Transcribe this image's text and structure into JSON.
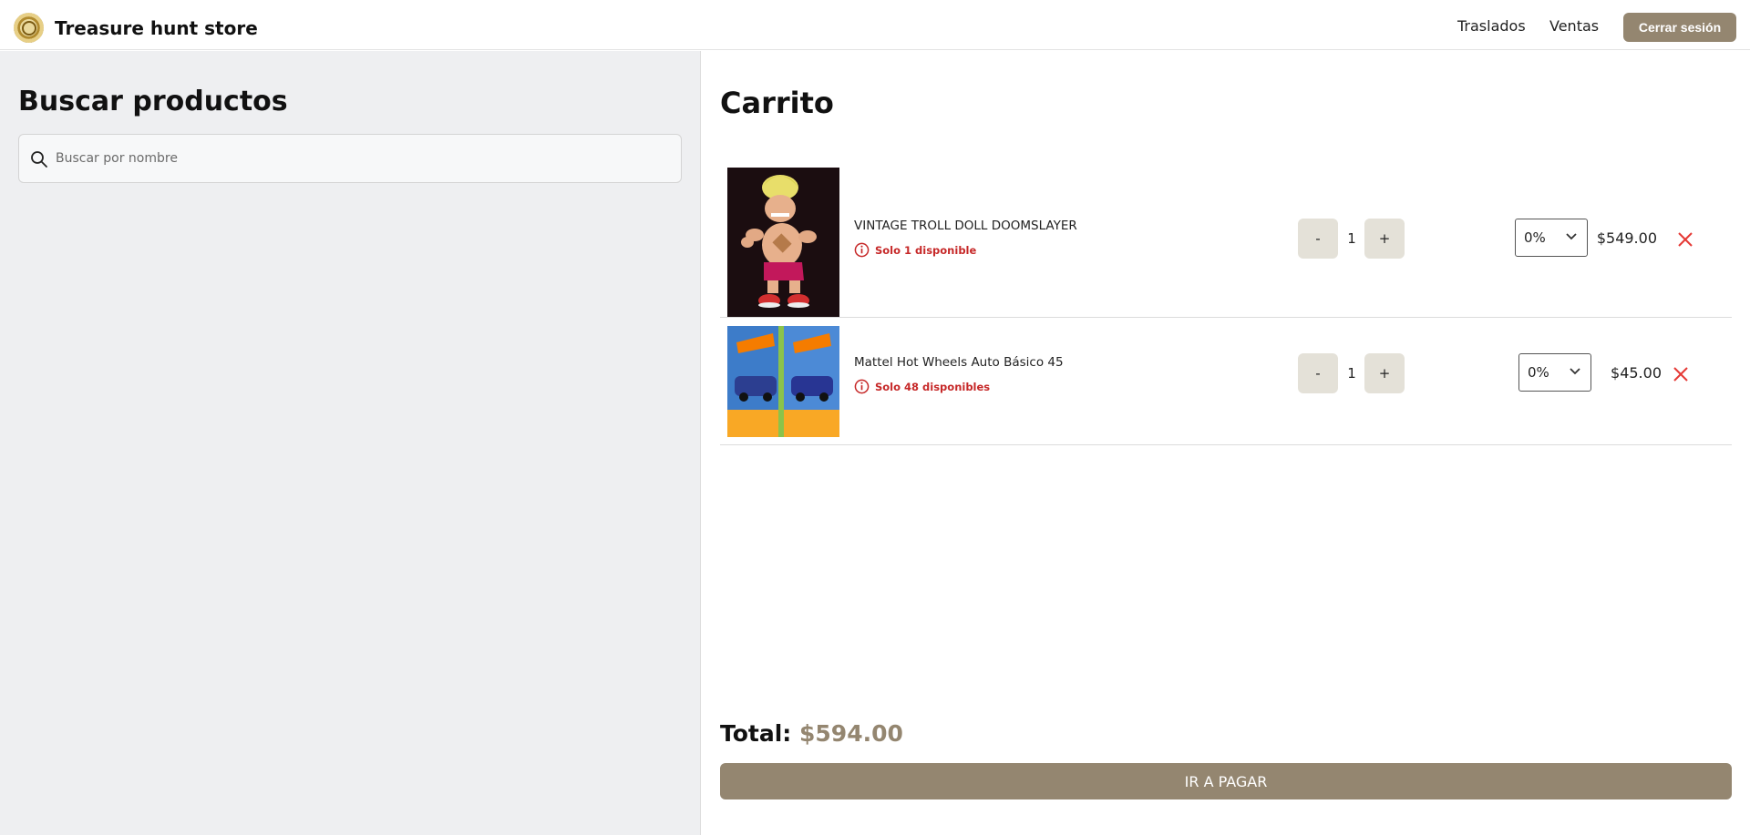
{
  "header": {
    "store_name": "Treasure hunt store",
    "nav": [
      {
        "label": "Traslados"
      },
      {
        "label": "Ventas"
      }
    ],
    "logout_label": "Cerrar sesión"
  },
  "search": {
    "title": "Buscar productos",
    "placeholder": "Buscar por nombre",
    "value": ""
  },
  "cart": {
    "title": "Carrito",
    "items": [
      {
        "name": "VINTAGE TROLL DOLL DOOMSLAYER",
        "stock_note": "Solo 1 disponible",
        "quantity": "1",
        "discount": "0%",
        "price": "$549.00",
        "minus": "-",
        "plus": "+"
      },
      {
        "name": "Mattel Hot Wheels Auto Básico 45",
        "stock_note": "Solo 48 disponibles",
        "quantity": "1",
        "discount": "0%",
        "price": "$45.00",
        "minus": "-",
        "plus": "+"
      }
    ],
    "total_label": "Total:",
    "total_value": "$594.00",
    "pay_label": "IR A PAGAR"
  },
  "colors": {
    "accent": "#948670",
    "warning": "#c62828",
    "left_bg": "#eeeff1"
  }
}
